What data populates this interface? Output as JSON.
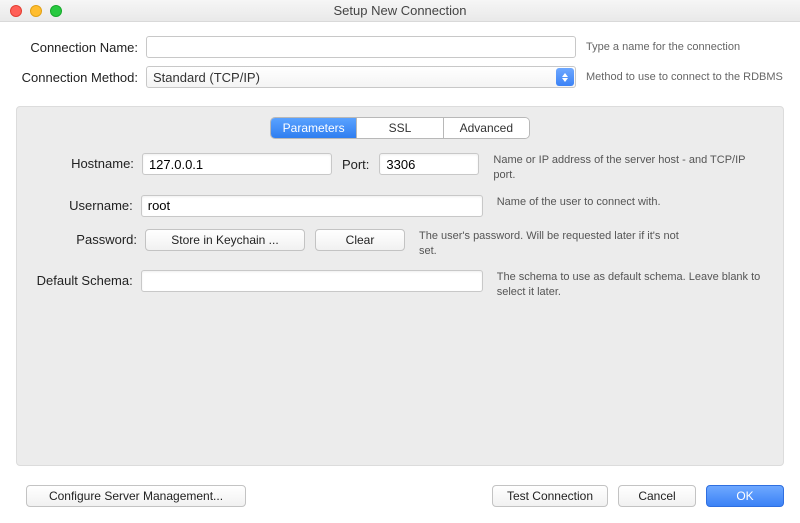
{
  "window": {
    "title": "Setup New Connection"
  },
  "top": {
    "conn_name_label": "Connection Name:",
    "conn_name_value": "",
    "conn_name_hint": "Type a name for the connection",
    "method_label": "Connection Method:",
    "method_value": "Standard (TCP/IP)",
    "method_hint": "Method to use to connect to the RDBMS"
  },
  "tabs": {
    "parameters": "Parameters",
    "ssl": "SSL",
    "advanced": "Advanced"
  },
  "params": {
    "hostname_label": "Hostname:",
    "hostname_value": "127.0.0.1",
    "port_label": "Port:",
    "port_value": "3306",
    "hostname_hint": "Name or IP address of the server host - and TCP/IP port.",
    "username_label": "Username:",
    "username_value": "root",
    "username_hint": "Name of the user to connect with.",
    "password_label": "Password:",
    "store_keychain": "Store in Keychain ...",
    "clear": "Clear",
    "password_hint": "The user's password. Will be requested later if it's not set.",
    "schema_label": "Default Schema:",
    "schema_value": "",
    "schema_hint": "The schema to use as default schema. Leave blank to select it later."
  },
  "footer": {
    "configure": "Configure Server Management...",
    "test": "Test Connection",
    "cancel": "Cancel",
    "ok": "OK"
  }
}
